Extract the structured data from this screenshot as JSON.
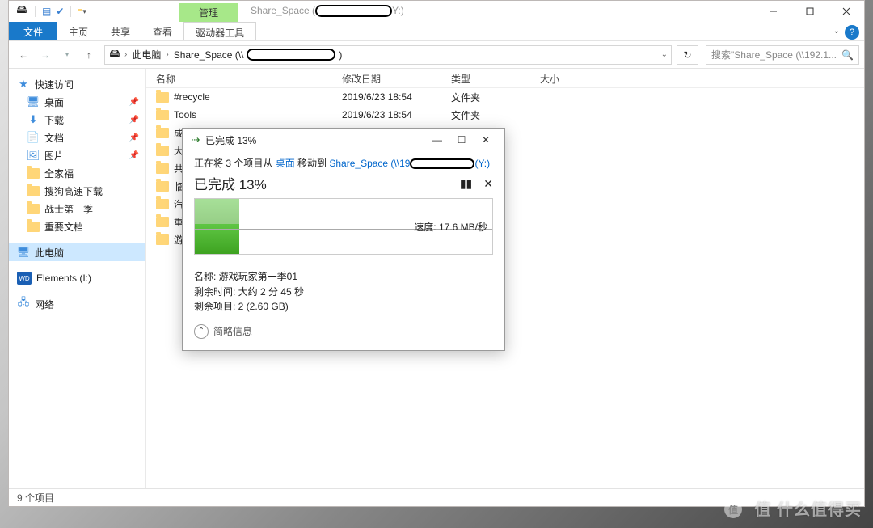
{
  "window": {
    "title_prefix": "Share_Space (",
    "title_suffix": "Y:)",
    "context_tab": "管理",
    "ribbon": {
      "file": "文件",
      "tabs": [
        "主页",
        "共享",
        "查看"
      ],
      "tools": "驱动器工具"
    }
  },
  "nav": {
    "breadcrumb": [
      "此电脑",
      "Share_Space (\\\\"
    ],
    "bc_tail": ")",
    "search_placeholder": "搜索\"Share_Space (\\\\192.1..."
  },
  "sidebar": {
    "quick": "快速访问",
    "items": [
      {
        "icon": "desktop",
        "label": "桌面",
        "pin": true
      },
      {
        "icon": "download",
        "label": "下载",
        "pin": true
      },
      {
        "icon": "doc",
        "label": "文档",
        "pin": true
      },
      {
        "icon": "pic",
        "label": "图片",
        "pin": true
      },
      {
        "icon": "folder",
        "label": "全家福"
      },
      {
        "icon": "folder",
        "label": "搜狗高速下载"
      },
      {
        "icon": "folder",
        "label": "战士第一季"
      },
      {
        "icon": "folder",
        "label": "重要文档"
      }
    ],
    "thispc": "此电脑",
    "drive": "Elements (I:)",
    "network": "网络"
  },
  "columns": {
    "name": "名称",
    "date": "修改日期",
    "type": "类型",
    "size": "大小"
  },
  "rows": [
    {
      "name": "#recycle",
      "date": "2019/6/23 18:54",
      "type": "文件夹"
    },
    {
      "name": "Tools",
      "date": "2019/6/23 18:54",
      "type": "文件夹"
    },
    {
      "name": "成品"
    },
    {
      "name": "大小宝"
    },
    {
      "name": "共享"
    },
    {
      "name": "临时"
    },
    {
      "name": "汽车"
    },
    {
      "name": "重要文"
    },
    {
      "name": "游戏玩"
    }
  ],
  "status": "9 个项目",
  "dialog": {
    "title": "已完成 13%",
    "moving_a": "正在将 3 个项目从 ",
    "src": "桌面",
    "moving_b": " 移动到 ",
    "dst_a": "Share_Space (\\\\19",
    "dst_b": "(Y:)",
    "done": "已完成 13%",
    "speed": "速度: 17.6 MB/秒",
    "name_lbl": "名称: ",
    "name_val": "游戏玩家第一季01",
    "time_lbl": "剩余时间: ",
    "time_val": "大约 2 分 45 秒",
    "items_lbl": "剩余项目: ",
    "items_val": "2 (2.60 GB)",
    "more": "简略信息"
  },
  "watermark": "值 什么值得买"
}
